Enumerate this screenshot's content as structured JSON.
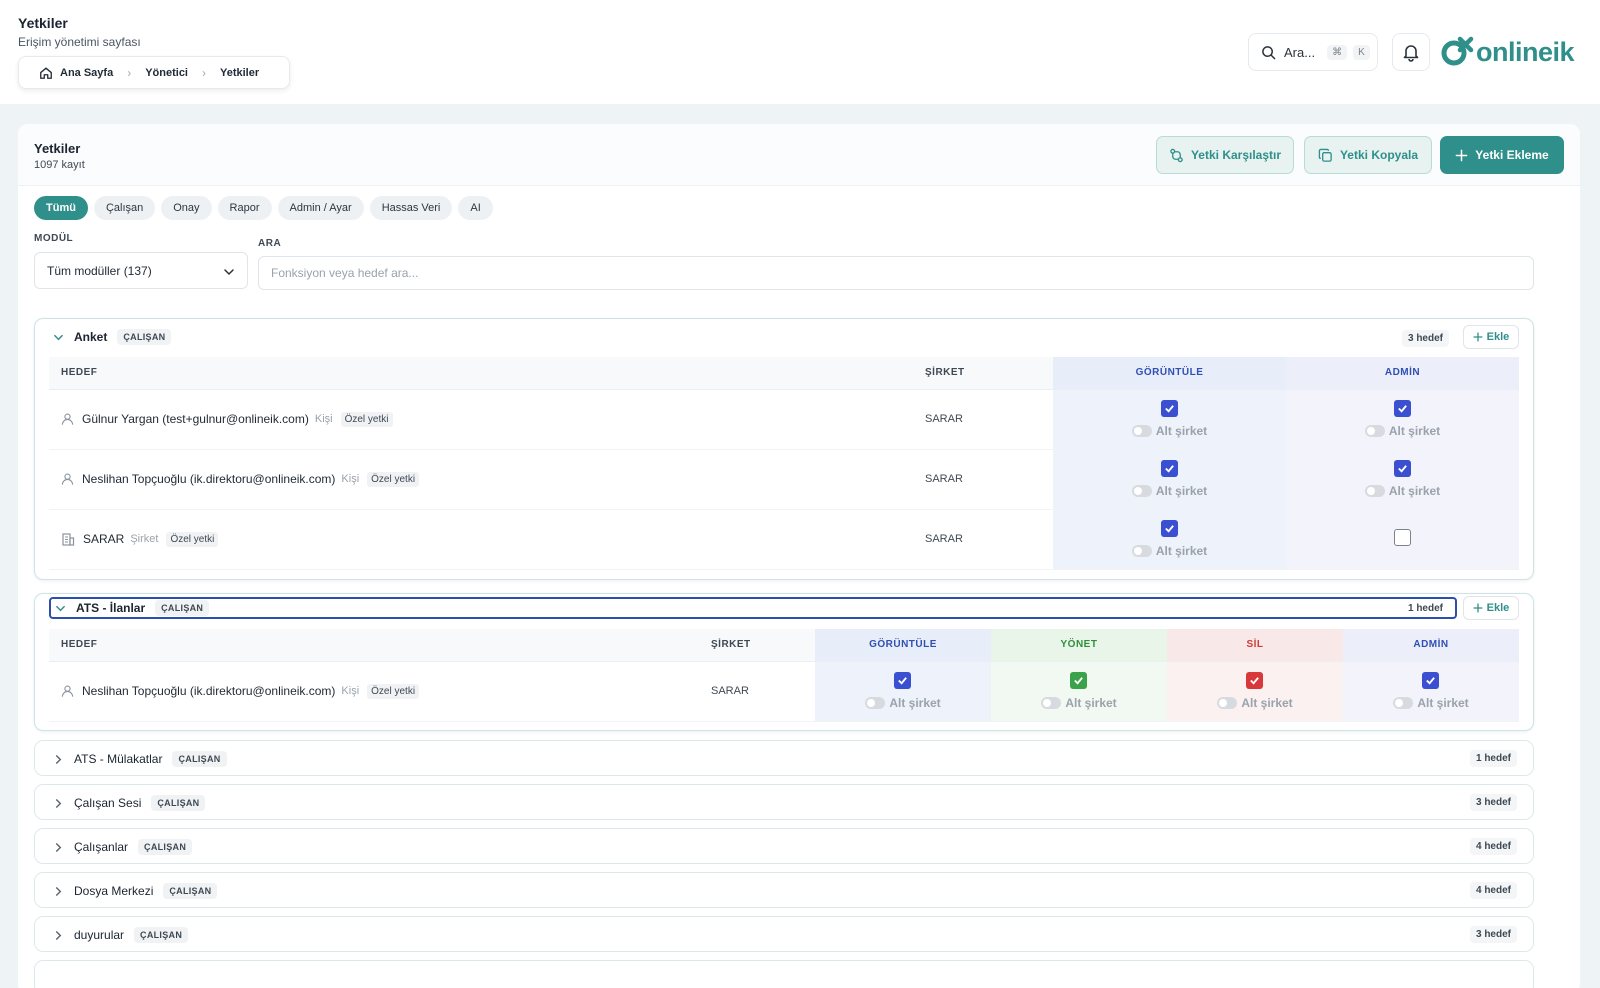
{
  "header": {
    "title": "Yetkiler",
    "subtitle": "Erişim yönetimi sayfası",
    "breadcrumb": [
      "Ana Sayfa",
      "Yönetici",
      "Yetkiler"
    ],
    "search_placeholder": "Ara...",
    "shortcut": [
      "⌘",
      "K"
    ],
    "logo_text": "onlineik"
  },
  "card": {
    "title": "Yetkiler",
    "count": "1097 kayıt",
    "buttons": {
      "compare": "Yetki Karşılaştır",
      "copy": "Yetki Kopyala",
      "add": "Yetki Ekleme"
    },
    "chips": [
      "Tümü",
      "Çalışan",
      "Onay",
      "Rapor",
      "Admin / Ayar",
      "Hassas Veri",
      "AI"
    ],
    "module_label": "MODÜL",
    "module_value": "Tüm modüller (137)",
    "search_label": "ARA",
    "search_placeholder": "Fonksiyon veya hedef ara..."
  },
  "common": {
    "add_label": "Ekle",
    "alt_label": "Alt şirket",
    "col_target": "HEDEF",
    "col_company": "ŞİRKET",
    "col_view": "GÖRÜNTÜLE",
    "col_manage": "YÖNET",
    "col_delete": "SİL",
    "col_admin": "ADMİN",
    "special": "Özel yetki"
  },
  "groups": [
    {
      "name": "Anket",
      "tag": "ÇALIŞAN",
      "count": "3 hedef",
      "rows": [
        {
          "name": "Gülnur Yargan (test+gulnur@onlineik.com)",
          "kind": "Kişi",
          "company": "SARAR",
          "view": true,
          "admin": true
        },
        {
          "name": "Neslihan Topçuoğlu (ik.direktoru@onlineik.com)",
          "kind": "Kişi",
          "company": "SARAR",
          "view": true,
          "admin": true
        },
        {
          "name": "SARAR",
          "kind": "Şirket",
          "company": "SARAR",
          "view": true,
          "admin": false
        }
      ]
    },
    {
      "name": "ATS - İlanlar",
      "tag": "ÇALIŞAN",
      "count": "1 hedef",
      "rows": [
        {
          "name": "Neslihan Topçuoğlu (ik.direktoru@onlineik.com)",
          "kind": "Kişi",
          "company": "SARAR",
          "view": true,
          "manage": true,
          "delete": true,
          "admin": true
        }
      ]
    },
    {
      "name": "ATS - Mülakatlar",
      "tag": "ÇALIŞAN",
      "count": "1 hedef"
    },
    {
      "name": "Çalışan Sesi",
      "tag": "ÇALIŞAN",
      "count": "3 hedef"
    },
    {
      "name": "Çalışanlar",
      "tag": "ÇALIŞAN",
      "count": "4 hedef"
    },
    {
      "name": "Dosya Merkezi",
      "tag": "ÇALIŞAN",
      "count": "4 hedef"
    },
    {
      "name": "duyurular",
      "tag": "ÇALIŞAN",
      "count": "3 hedef"
    }
  ],
  "colors": {
    "brand": "#2f8f8a",
    "view": "#3b4fd1",
    "manage": "#3aa24a",
    "delete": "#d9383a"
  }
}
